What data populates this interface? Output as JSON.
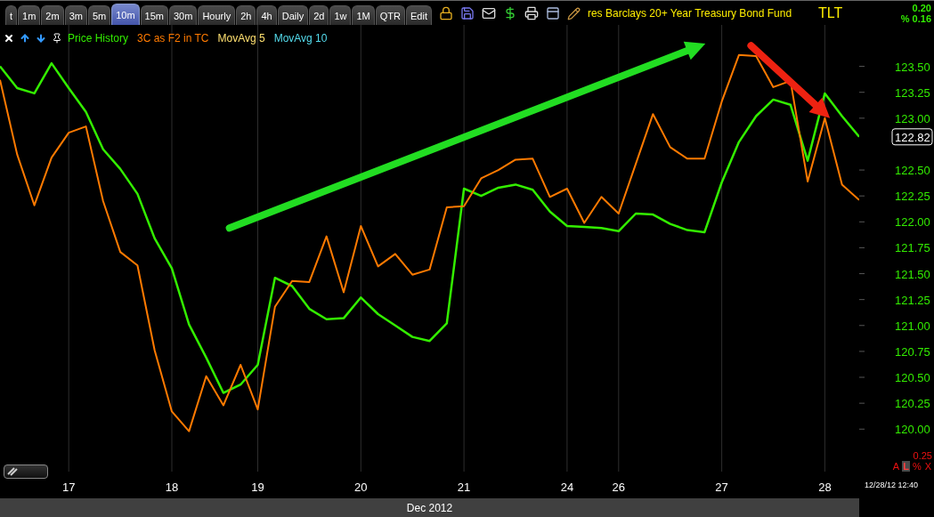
{
  "toolbar": {
    "tabs": [
      {
        "label": "t",
        "selected": false
      },
      {
        "label": "1m",
        "selected": false
      },
      {
        "label": "2m",
        "selected": false
      },
      {
        "label": "3m",
        "selected": false
      },
      {
        "label": "5m",
        "selected": false
      },
      {
        "label": "10m",
        "selected": true
      },
      {
        "label": "15m",
        "selected": false
      },
      {
        "label": "30m",
        "selected": false
      },
      {
        "label": "Hourly",
        "selected": false
      },
      {
        "label": "2h",
        "selected": false
      },
      {
        "label": "4h",
        "selected": false
      },
      {
        "label": "Daily",
        "selected": false
      },
      {
        "label": "2d",
        "selected": false
      },
      {
        "label": "1w",
        "selected": false
      },
      {
        "label": "1M",
        "selected": false
      },
      {
        "label": "QTR",
        "selected": false
      },
      {
        "label": "Edit",
        "selected": false
      }
    ],
    "title": "res Barclays 20+ Year Treasury Bond Fund",
    "symbol": "TLT",
    "change": "0.20",
    "change_percent": "% 0.16"
  },
  "legend": [
    {
      "label": "MovAvg 5",
      "color": "#ffe070"
    },
    {
      "label": "MovAvg 10",
      "color": "#55ddee"
    }
  ],
  "chart_data": {
    "type": "line",
    "grid": true,
    "ylim": [
      119.59,
      123.9
    ],
    "categories": [
      null,
      null,
      null,
      null,
      "17",
      null,
      null,
      null,
      null,
      null,
      "18",
      null,
      null,
      null,
      null,
      "19",
      null,
      null,
      null,
      null,
      null,
      "20",
      null,
      null,
      null,
      null,
      null,
      "21",
      null,
      null,
      null,
      null,
      null,
      "24",
      null,
      null,
      "26",
      null,
      null,
      null,
      null,
      null,
      "27",
      null,
      null,
      null,
      null,
      null,
      "28",
      null,
      null
    ],
    "yticks": [
      {
        "value": 120,
        "label": "120.00"
      },
      {
        "value": 120.25,
        "label": "120.25"
      },
      {
        "value": 120.5,
        "label": "120.50"
      },
      {
        "value": 120.75,
        "label": "120.75"
      },
      {
        "value": 121,
        "label": "121.00"
      },
      {
        "value": 121.25,
        "label": "121.25"
      },
      {
        "value": 121.5,
        "label": "121.50"
      },
      {
        "value": 121.75,
        "label": "121.75"
      },
      {
        "value": 122,
        "label": "122.00"
      },
      {
        "value": 122.25,
        "label": "122.25"
      },
      {
        "value": 122.5,
        "label": "122.50"
      },
      {
        "value": 123,
        "label": "123.00"
      },
      {
        "value": 123.25,
        "label": "123.25"
      },
      {
        "value": 123.5,
        "label": "123.50"
      }
    ],
    "series": [
      {
        "name": "Price History",
        "color": "#33ee00",
        "values": [
          123.5,
          123.29,
          123.24,
          123.53,
          123.29,
          123.06,
          122.7,
          122.51,
          122.27,
          121.84,
          121.55,
          121.01,
          120.69,
          120.35,
          120.43,
          120.62,
          121.46,
          121.38,
          121.16,
          121.06,
          121.07,
          121.27,
          121.11,
          121.0,
          120.89,
          120.85,
          121.02,
          122.32,
          122.25,
          122.33,
          122.36,
          122.31,
          122.1,
          121.96,
          121.95,
          121.94,
          121.91,
          122.08,
          122.07,
          121.98,
          121.92,
          121.9,
          122.38,
          122.77,
          123.02,
          123.18,
          123.13,
          122.59,
          123.24,
          123.02,
          122.82
        ]
      },
      {
        "name": "3C as F2 in TC",
        "color": "#ff7a00",
        "values": [
          123.37,
          122.65,
          122.16,
          122.62,
          122.86,
          122.92,
          122.2,
          121.71,
          121.58,
          120.76,
          120.17,
          119.98,
          120.51,
          120.23,
          120.62,
          120.19,
          121.18,
          121.43,
          121.42,
          121.86,
          121.32,
          121.96,
          121.57,
          121.69,
          121.49,
          121.54,
          122.14,
          122.15,
          122.42,
          122.5,
          122.6,
          122.61,
          122.24,
          122.32,
          121.99,
          122.24,
          122.08,
          122.56,
          123.04,
          122.72,
          122.61,
          122.61,
          123.16,
          123.61,
          123.6,
          123.3,
          123.36,
          122.39,
          123.0,
          122.36,
          122.21
        ]
      }
    ]
  },
  "last_price": "122.82",
  "scale": {
    "value": "0.25",
    "buttons": [
      {
        "label": "A",
        "selected": false
      },
      {
        "label": "L",
        "selected": true
      },
      {
        "label": "%",
        "selected": false
      },
      {
        "label": "X",
        "selected": false
      }
    ]
  },
  "timestamp": "12/28/12 12:40",
  "x_axis_month": "Dec 2012"
}
